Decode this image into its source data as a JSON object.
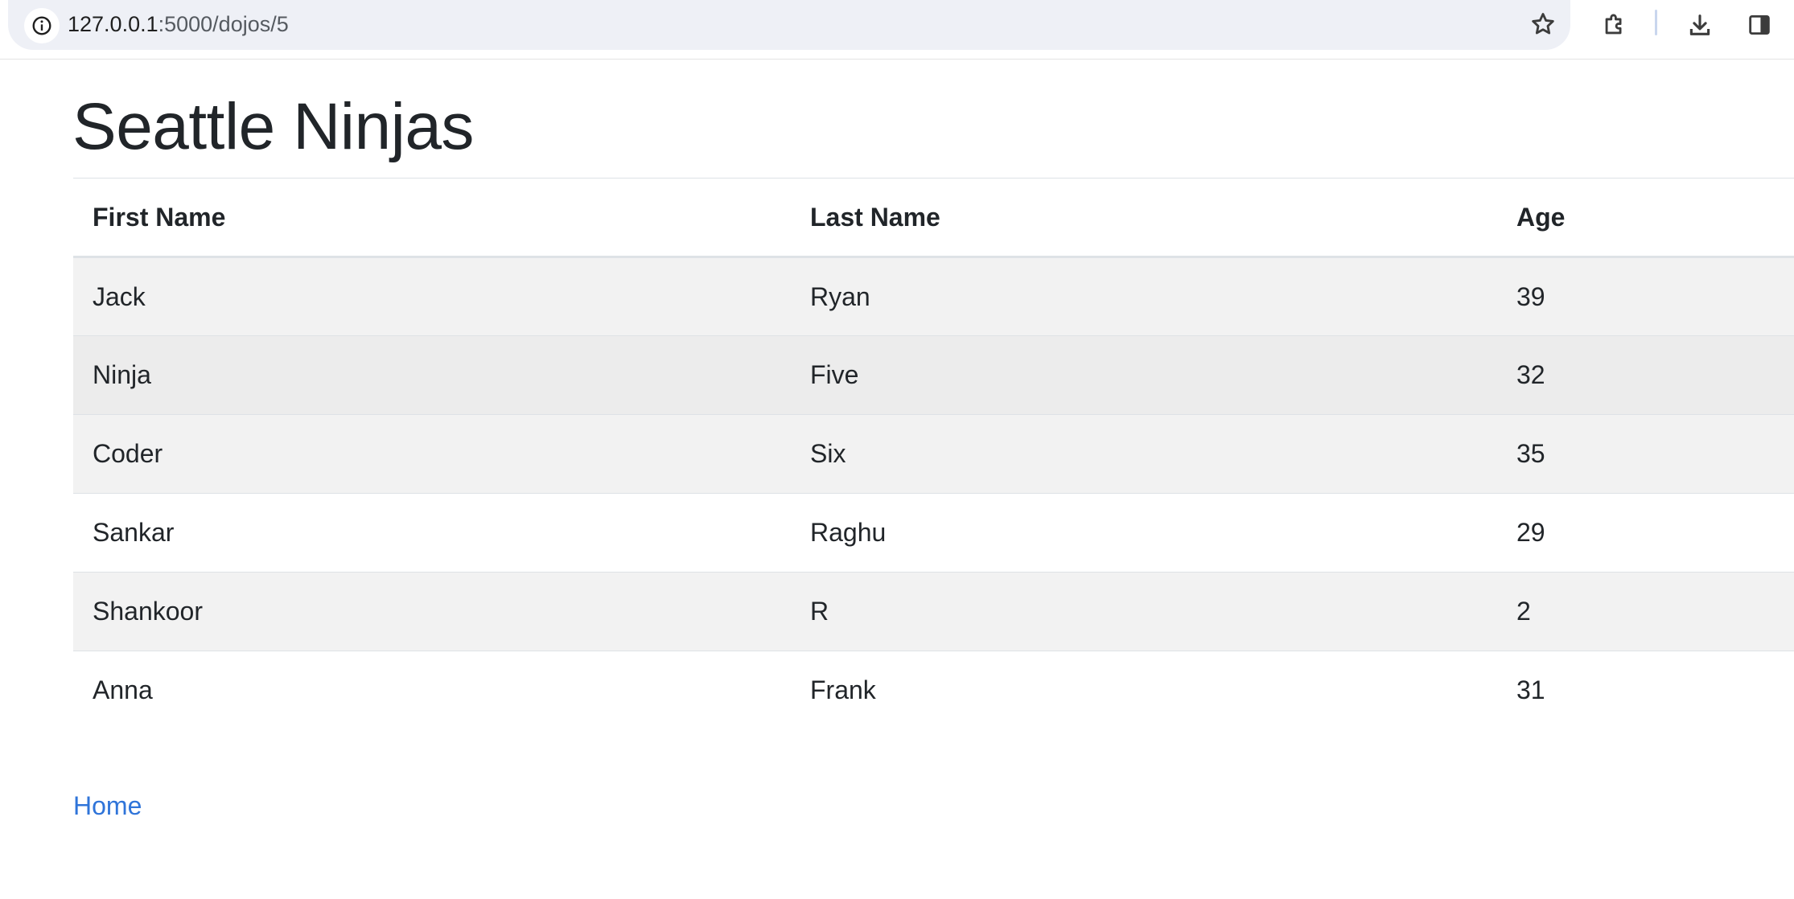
{
  "browser": {
    "url_host": "127.0.0.1",
    "url_path": ":5000/dojos/5",
    "icons": {
      "site_info": "info-circle-icon",
      "bookmark": "star-icon",
      "extensions": "puzzle-icon",
      "downloads": "download-icon",
      "side_panel": "side-panel-icon"
    }
  },
  "page": {
    "title": "Seattle Ninjas",
    "table": {
      "headers": [
        "First Name",
        "Last Name",
        "Age"
      ],
      "rows": [
        {
          "first": "Jack",
          "last": "Ryan",
          "age": "39"
        },
        {
          "first": "Ninja",
          "last": "Five",
          "age": "32"
        },
        {
          "first": "Coder",
          "last": "Six",
          "age": "35"
        },
        {
          "first": "Sankar",
          "last": "Raghu",
          "age": "29"
        },
        {
          "first": "Shankoor",
          "last": "R",
          "age": "2"
        },
        {
          "first": "Anna",
          "last": "Frank",
          "age": "31"
        }
      ]
    },
    "home_link": "Home"
  },
  "colors": {
    "link": "#2f74d9",
    "stripe": "#f2f2f2",
    "hover_row": "#ececec",
    "omnibox_bg": "#eef0f6"
  }
}
